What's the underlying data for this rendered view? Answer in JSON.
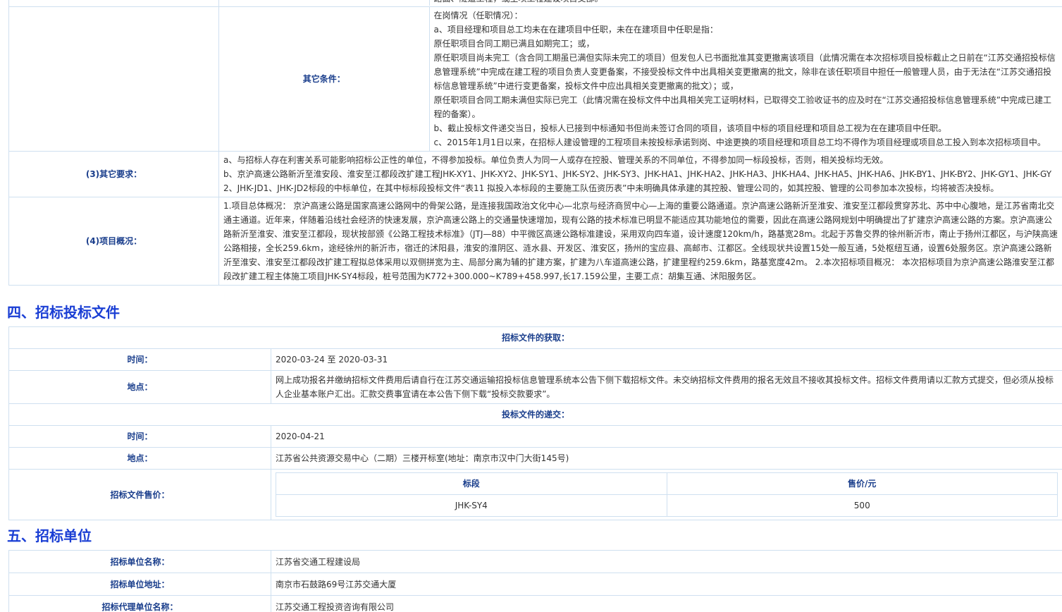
{
  "top_fragment": "路面、隧道工程，或全项工程建设项目交部。",
  "other_conditions": {
    "label": "其它条件：",
    "lines": [
      "在岗情况（任职情况）：",
      "a、项目经理和项目总工均未在在建项目中任职，未在在建项目中任职是指：",
      "原任职项目合同工期已满且如期完工；或，",
      "原任职项目尚未完工（含合同工期虽已满但实际未完工的项目）但发包人已书面批准其变更撤离该项目（此情况需在本次招标项目投标截止之日前在“江苏交通招投标信息管理系统”中完成在建工程的项目负责人变更备案，不接受投标文件中出具相关变更撤离的批文，除非在该任职项目中担任一般管理人员，由于无法在“江苏交通招投标信息管理系统”中进行变更备案，投标文件中应出具相关变更撤离的批文）；或，",
      "原任职项目合同工期未满但实际已完工（此情况需在投标文件中出具相关完工证明材料，已取得交工验收证书的应及时在“江苏交通招投标信息管理系统”中完成已建工程的备案）。",
      "b、截止投标文件递交当日，投标人已接到中标通知书但尚未签订合同的项目，该项目中标的项目经理和项目总工视为在在建项目中任职。",
      "c、2015年1月1日以来，在招标人建设管理的工程项目未按投标承诺到岗、中途更换的项目经理和项目总工均不得作为项目经理或项目总工投入到本次招标项目中。"
    ]
  },
  "other_requirements": {
    "label": "(3)其它要求：",
    "lines": [
      "a、与招标人存在利害关系可能影响招标公正性的单位，不得参加投标。单位负责人为同一人或存在控股、管理关系的不同单位，不得参加同一标段投标，否则，相关投标均无效。",
      "b、京沪高速公路新沂至淮安段、淮安至江都段改扩建工程JHK-XY1、JHK-XY2、JHK-SY1、JHK-SY2、JHK-SY3、JHK-HA1、JHK-HA2、JHK-HA3、JHK-HA4、JHK-HA5、JHK-HA6、JHK-BY1、JHK-BY2、JHK-GY1、JHK-GY2、JHK-JD1、JHK-JD2标段的中标单位，在其中标标段投标文件“表11 拟投入本标段的主要施工队伍资历表”中未明确具体承建的其控股、管理公司的，如其控股、管理的公司参加本次投标，均将被否决投标。"
    ]
  },
  "project_overview": {
    "label": "(4)项目概况：",
    "text": "1.项目总体概况： 京沪高速公路是国家高速公路网中的骨架公路，是连接我国政治文化中心—北京与经济商贸中心—上海的重要公路通道。京沪高速公路新沂至淮安、淮安至江都段贯穿苏北、苏中中心腹地，是江苏省南北交通主通道。近年来，伴随着沿线社会经济的快速发展，京沪高速公路上的交通量快速增加，现有公路的技术标准已明显不能适应其功能地位的需要，因此在高速公路网规划中明确提出了扩建京沪高速公路的方案。京沪高速公路新沂至淮安、淮安至江都段，现状按部颁《公路工程技术标准》（JTJ—88）中平微区高速公路标准建设，采用双向四车道，设计速度120km/h，路基宽28m。北起于苏鲁交界的徐州新沂市，南止于扬州江都区，与沪陕高速公路相接，全长259.6km，途经徐州的新沂市，宿迁的沭阳县，淮安的淮阴区、涟水县、开发区、淮安区，扬州的宝应县、高邮市、江都区。全线现状共设置15处一般互通，5处枢纽互通，设置6处服务区。京沪高速公路新沂至淮安、淮安至江都段改扩建工程拟总体采用以双侧拼宽为主、局部分离为辅的扩建方案，扩建为八车道高速公路，扩建里程约259.6km，路基宽度42m。 2.本次招标项目概况： 本次招标项目为京沪高速公路淮安至江都段改扩建工程主体施工项目JHK-SY4标段，桩号范围为K772+300.000~K789+458.997,长17.159公里，主要工点：胡集互通、沭阳服务区。"
  },
  "section4": {
    "title": "四、招标投标文件",
    "acquire_head": "招标文件的获取：",
    "acquire_time_label": "时间：",
    "acquire_time": "2020-03-24 至 2020-03-31",
    "acquire_place_label": "地点：",
    "acquire_place": "网上成功报名并缴纳招标文件费用后请自行在江苏交通运输招投标信息管理系统本公告下侧下载招标文件。未交纳招标文件费用的报名无效且不接收其投标文件。招标文件费用请以汇款方式提交，但必须从投标人企业基本账户汇出。汇款交费事宜请在本公告下侧下载“投标交款要求”。",
    "submit_head": "投标文件的递交：",
    "submit_time_label": "时间：",
    "submit_time": "2020-04-21",
    "submit_place_label": "地点：",
    "submit_place": "江苏省公共资源交易中心（二期）三楼开标室(地址：南京市汉中门大街145号)",
    "price_label": "招标文件售价：",
    "price_table": {
      "headers": [
        "标段",
        "售价/元"
      ],
      "rows": [
        [
          "JHK-SY4",
          "500"
        ]
      ]
    }
  },
  "section5": {
    "title": "五、招标单位",
    "name_label": "招标单位名称：",
    "name": "江苏省交通工程建设局",
    "addr_label": "招标单位地址：",
    "addr": "南京市石鼓路69号江苏交通大厦",
    "agent_label": "招标代理单位名称：",
    "agent": "江苏交通工程投资咨询有限公司"
  }
}
